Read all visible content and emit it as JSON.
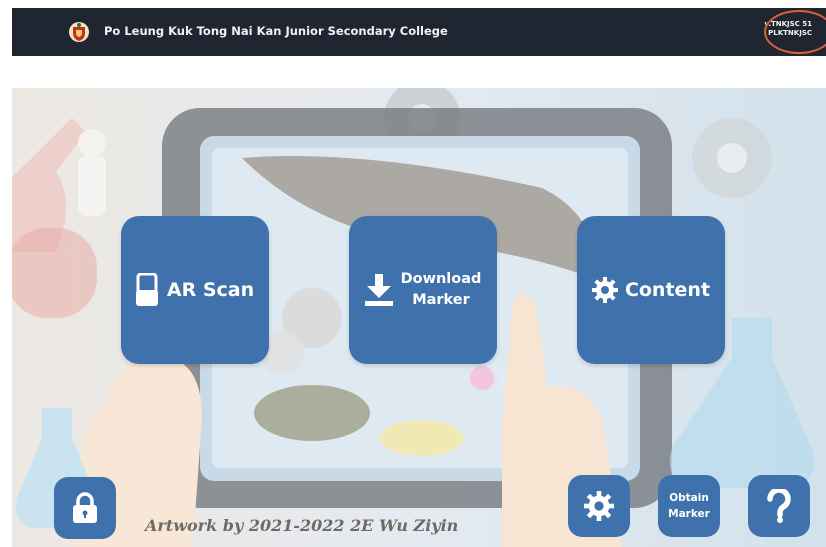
{
  "header": {
    "college_name": "Po Leung Kuk Tong Nai Kan Junior Secondary College",
    "version_line1": "v.TNKJSC 51",
    "version_line2": "PLKTNKJSC",
    "crest_icon": "school-crest-icon"
  },
  "main_buttons": {
    "ar_scan": {
      "label": "AR Scan",
      "icon": "phone-scan-icon"
    },
    "download_marker": {
      "label_line1": "Download",
      "label_line2": "Marker",
      "icon": "download-icon"
    },
    "content": {
      "label": "Content",
      "icon": "gear-icon"
    }
  },
  "bottom_bar": {
    "lock": {
      "icon": "lock-icon"
    },
    "settings": {
      "icon": "gear-icon"
    },
    "obtain_marker": {
      "label_line1": "Obtain",
      "label_line2": "Marker"
    },
    "help": {
      "icon": "question-icon"
    }
  },
  "artwork_credit": "Artwork by 2021-2022 2E Wu Ziyin",
  "colors": {
    "button_blue": "#3f72ad",
    "header_bg": "#1f2631",
    "highlight_ring": "#d9632f"
  }
}
